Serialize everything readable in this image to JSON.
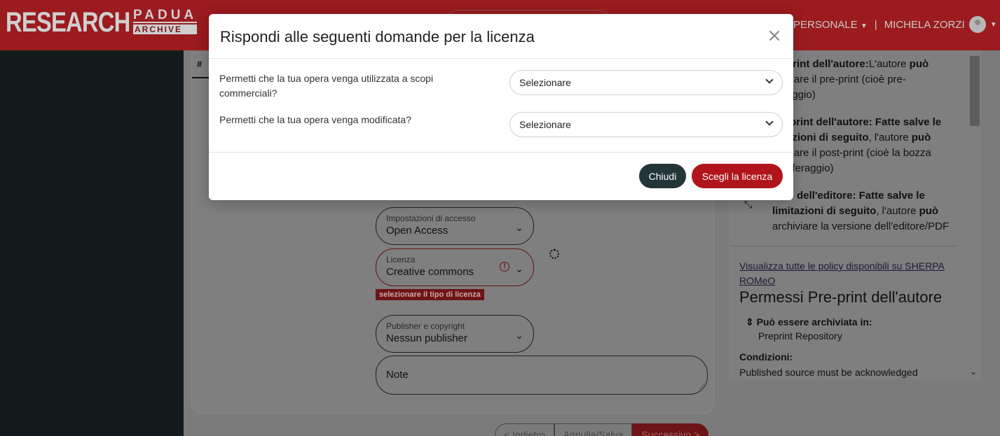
{
  "header": {
    "logo_main": "RESEARCH",
    "logo_padua": "PADUA",
    "logo_archive": "ARCHIVE",
    "nav_personal": "PERSONALE",
    "user_name": "MICHELA ZORZI"
  },
  "form": {
    "hash": "#",
    "access": {
      "label": "Impostazioni di accesso",
      "value": "Open Access"
    },
    "license": {
      "label": "Licenza",
      "value": "Creative commons",
      "error": "selezionare il tipo di licenza"
    },
    "publisher": {
      "label": "Publisher e copyright",
      "value": "Nessun publisher"
    },
    "note_placeholder": "Note"
  },
  "pager": {
    "prev": "< Indietro",
    "save": "Annulla/Salva",
    "next": "Successivo >"
  },
  "right_panel": {
    "preprint_title": "print dell'autore:",
    "preprint_text_a": "L'autore ",
    "preprint_can": "può",
    "preprint_text_b": "viare il pre-print (cioè pre-",
    "preprint_text_c": "aggio)",
    "postprint_title": "-print dell'autore: Fatte salve le",
    "postprint_line2": "azioni di seguito",
    "postprint_line2b": ", l'autore ",
    "postprint_can": "può",
    "postprint_line3": "viare il post-print (cioè la bozza",
    "postprint_line4": "eferaggio)",
    "editor_title": "ione dell'editore: Fatte salve le",
    "editor_line2": "limitazioni di seguito",
    "editor_line2b": ", l'autore ",
    "editor_can": "può",
    "editor_line3": "archiviare la versione dell'editore/PDF",
    "sherpa_link": "Visualizza tutte le policy disponibili su SHERPA ROMeO",
    "section_title": "Permessi Pre-print dell'autore",
    "archivable_label": "Può essere archiviata in:",
    "archivable_value": "Preprint Repository",
    "conditions_label": "Condizioni:",
    "conditions_value": "Published source must be acknowledged"
  },
  "modal": {
    "title": "Rispondi alle seguenti domande per la licenza",
    "questions": [
      {
        "label": "Permetti che la tua opera venga utilizzata a scopi commerciali?",
        "selected": "Selezionare"
      },
      {
        "label": "Permetti che la tua opera venga modificata?",
        "selected": "Selezionare"
      }
    ],
    "close_label": "Chiudi",
    "choose_label": "Scegli la licenza"
  },
  "colors": {
    "brand": "#9b1b1f",
    "primary_button": "#b0151c",
    "dark_button": "#243538"
  }
}
